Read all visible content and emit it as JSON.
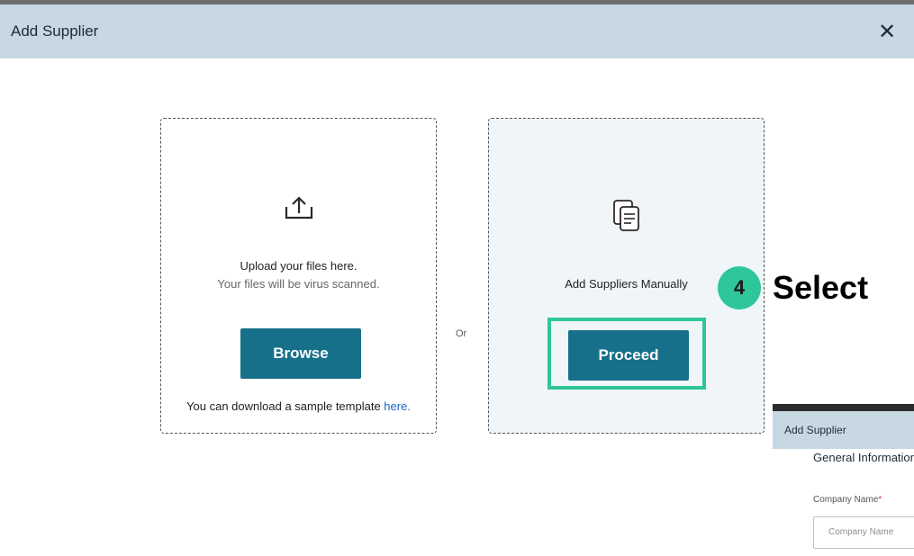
{
  "dialog": {
    "title": "Add Supplier",
    "close_glyph": "✕"
  },
  "upload_card": {
    "icon": "upload-icon",
    "title": "Upload your files here.",
    "subtitle": "Your files will be virus scanned.",
    "button_label": "Browse",
    "template_text": "You can download a sample template ",
    "template_link": "here."
  },
  "separator_label": "Or",
  "manual_card": {
    "icon": "document-copy-icon",
    "title": "Add Suppliers Manually",
    "button_label": "Proceed"
  },
  "annotation": {
    "step_number": "4",
    "step_text": "Select",
    "highlight_color": "#2fc69a"
  },
  "preview": {
    "header_title": "Add Supplier",
    "section_title": "General Information",
    "company_label": "Company Name",
    "required_mark": "*",
    "company_placeholder": "Company Name"
  },
  "colors": {
    "header_bg": "#c7d8e3",
    "primary_button": "#17708a",
    "link": "#1b64c6",
    "badge": "#2ec69b"
  }
}
